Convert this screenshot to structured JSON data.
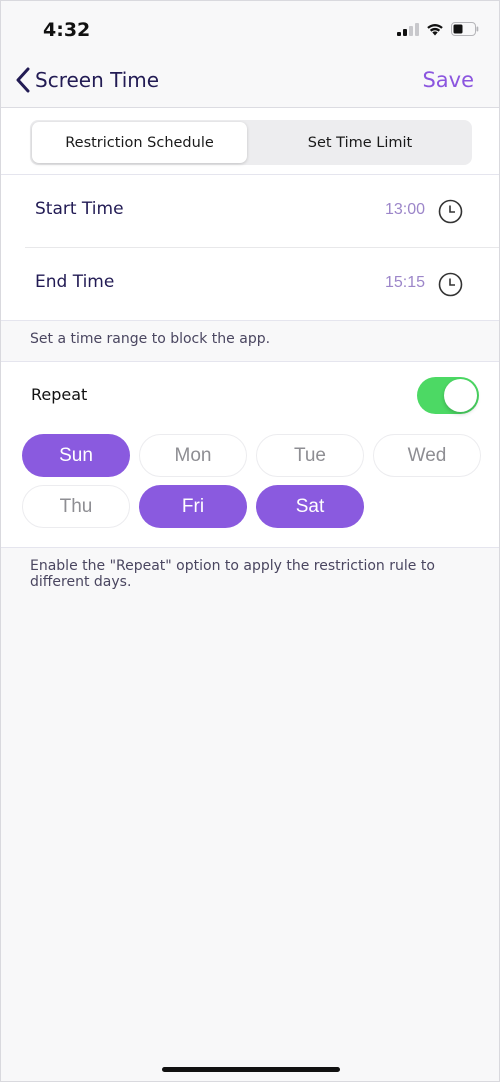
{
  "status_bar": {
    "time": "4:32",
    "icons": [
      "cellular-signal-icon",
      "wifi-icon",
      "battery-icon"
    ]
  },
  "nav": {
    "back_label": "Screen Time",
    "back_icon": "chevron-left-icon",
    "save_label": "Save"
  },
  "segments": {
    "items": [
      {
        "label": "Restriction Schedule",
        "active": true
      },
      {
        "label": "Set Time Limit",
        "active": false
      }
    ]
  },
  "times": {
    "start": {
      "label": "Start Time",
      "value": "13:00",
      "icon": "clock-icon"
    },
    "end": {
      "label": "End Time",
      "value": "15:15",
      "icon": "clock-icon"
    }
  },
  "hint_time": "Set a time range to block the app.",
  "repeat": {
    "label": "Repeat",
    "enabled": true,
    "days": [
      {
        "label": "Sun",
        "selected": true
      },
      {
        "label": "Mon",
        "selected": false
      },
      {
        "label": "Tue",
        "selected": false
      },
      {
        "label": "Wed",
        "selected": false
      },
      {
        "label": "Thu",
        "selected": false
      },
      {
        "label": "Fri",
        "selected": true
      },
      {
        "label": "Sat",
        "selected": true
      }
    ]
  },
  "hint_repeat": "Enable the \"Repeat\" option to apply the restriction rule to different days.",
  "colors": {
    "accent": "#8a5adf",
    "toggle_on": "#4cd964",
    "title_text": "#221b54",
    "time_value": "#9c86c9"
  }
}
